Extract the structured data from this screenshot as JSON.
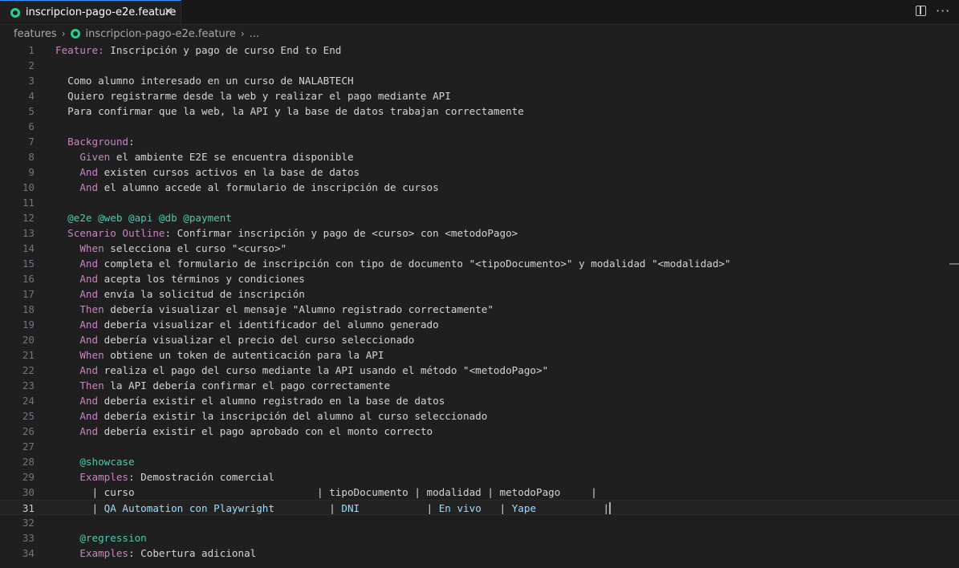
{
  "tab": {
    "title": "inscripcion-pago-e2e.feature",
    "icon": "gherkin-file-icon",
    "close": "✕"
  },
  "breadcrumb": {
    "folder": "features",
    "file": "inscripcion-pago-e2e.feature",
    "ellipsis": "..."
  },
  "colors": {
    "keyword": "#c586c0",
    "tag": "#4ec9b0",
    "table_value": "#9cdcfe",
    "text": "#d4d4d4",
    "accent": "#3794ff"
  },
  "lines": [
    {
      "n": "1",
      "segs": [
        {
          "t": "Feature:",
          "c": "kw"
        },
        {
          "t": " Inscripción y pago de curso End to End"
        }
      ]
    },
    {
      "n": "2",
      "segs": []
    },
    {
      "n": "3",
      "segs": [
        {
          "t": "  Como alumno interesado en un curso de NALABTECH"
        }
      ]
    },
    {
      "n": "4",
      "segs": [
        {
          "t": "  Quiero registrarme desde la web y realizar el pago mediante API"
        }
      ]
    },
    {
      "n": "5",
      "segs": [
        {
          "t": "  Para confirmar que la web, la API y la base de datos trabajan correctamente"
        }
      ]
    },
    {
      "n": "6",
      "segs": []
    },
    {
      "n": "7",
      "segs": [
        {
          "t": "  "
        },
        {
          "t": "Background",
          "c": "kw"
        },
        {
          "t": ":"
        }
      ]
    },
    {
      "n": "8",
      "segs": [
        {
          "t": "    "
        },
        {
          "t": "Given",
          "c": "kw"
        },
        {
          "t": " el ambiente E2E se encuentra disponible"
        }
      ]
    },
    {
      "n": "9",
      "segs": [
        {
          "t": "    "
        },
        {
          "t": "And",
          "c": "kw"
        },
        {
          "t": " existen cursos activos en la base de datos"
        }
      ]
    },
    {
      "n": "10",
      "segs": [
        {
          "t": "    "
        },
        {
          "t": "And",
          "c": "kw"
        },
        {
          "t": " el alumno accede al formulario de inscripción de cursos"
        }
      ]
    },
    {
      "n": "11",
      "segs": []
    },
    {
      "n": "12",
      "segs": [
        {
          "t": "  "
        },
        {
          "t": "@e2e @web @api @db @payment",
          "c": "tag"
        }
      ]
    },
    {
      "n": "13",
      "segs": [
        {
          "t": "  "
        },
        {
          "t": "Scenario Outline",
          "c": "kw"
        },
        {
          "t": ": Confirmar inscripción y pago de <curso> con <metodoPago>"
        }
      ]
    },
    {
      "n": "14",
      "segs": [
        {
          "t": "    "
        },
        {
          "t": "When",
          "c": "kw"
        },
        {
          "t": " selecciona el curso \"<curso>\""
        }
      ]
    },
    {
      "n": "15",
      "segs": [
        {
          "t": "    "
        },
        {
          "t": "And",
          "c": "kw"
        },
        {
          "t": " completa el formulario de inscripción con tipo de documento \"<tipoDocumento>\" y modalidad \"<modalidad>\""
        }
      ]
    },
    {
      "n": "16",
      "segs": [
        {
          "t": "    "
        },
        {
          "t": "And",
          "c": "kw"
        },
        {
          "t": " acepta los términos y condiciones"
        }
      ]
    },
    {
      "n": "17",
      "segs": [
        {
          "t": "    "
        },
        {
          "t": "And",
          "c": "kw"
        },
        {
          "t": " envía la solicitud de inscripción"
        }
      ]
    },
    {
      "n": "18",
      "segs": [
        {
          "t": "    "
        },
        {
          "t": "Then",
          "c": "kw"
        },
        {
          "t": " debería visualizar el mensaje \"Alumno registrado correctamente\""
        }
      ]
    },
    {
      "n": "19",
      "segs": [
        {
          "t": "    "
        },
        {
          "t": "And",
          "c": "kw"
        },
        {
          "t": " debería visualizar el identificador del alumno generado"
        }
      ]
    },
    {
      "n": "20",
      "segs": [
        {
          "t": "    "
        },
        {
          "t": "And",
          "c": "kw"
        },
        {
          "t": " debería visualizar el precio del curso seleccionado"
        }
      ]
    },
    {
      "n": "21",
      "segs": [
        {
          "t": "    "
        },
        {
          "t": "When",
          "c": "kw"
        },
        {
          "t": " obtiene un token de autenticación para la API"
        }
      ]
    },
    {
      "n": "22",
      "segs": [
        {
          "t": "    "
        },
        {
          "t": "And",
          "c": "kw"
        },
        {
          "t": " realiza el pago del curso mediante la API usando el método \"<metodoPago>\""
        }
      ]
    },
    {
      "n": "23",
      "segs": [
        {
          "t": "    "
        },
        {
          "t": "Then",
          "c": "kw"
        },
        {
          "t": " la API debería confirmar el pago correctamente"
        }
      ]
    },
    {
      "n": "24",
      "segs": [
        {
          "t": "    "
        },
        {
          "t": "And",
          "c": "kw"
        },
        {
          "t": " debería existir el alumno registrado en la base de datos"
        }
      ]
    },
    {
      "n": "25",
      "segs": [
        {
          "t": "    "
        },
        {
          "t": "And",
          "c": "kw"
        },
        {
          "t": " debería existir la inscripción del alumno al curso seleccionado"
        }
      ]
    },
    {
      "n": "26",
      "segs": [
        {
          "t": "    "
        },
        {
          "t": "And",
          "c": "kw"
        },
        {
          "t": " debería existir el pago aprobado con el monto correcto"
        }
      ]
    },
    {
      "n": "27",
      "segs": []
    },
    {
      "n": "28",
      "segs": [
        {
          "t": "    "
        },
        {
          "t": "@showcase",
          "c": "tag"
        }
      ]
    },
    {
      "n": "29",
      "segs": [
        {
          "t": "    "
        },
        {
          "t": "Examples",
          "c": "kw"
        },
        {
          "t": ": Demostración comercial"
        }
      ]
    },
    {
      "n": "30",
      "segs": [
        {
          "t": "      | curso                              | tipoDocumento | modalidad | metodoPago     |"
        }
      ]
    },
    {
      "n": "31",
      "current": true,
      "segs": [
        {
          "t": "      | "
        },
        {
          "t": "QA Automation con Playwright",
          "c": "tbl-val"
        },
        {
          "t": "         | "
        },
        {
          "t": "DNI",
          "c": "tbl-val"
        },
        {
          "t": "           | "
        },
        {
          "t": "En vivo",
          "c": "tbl-val"
        },
        {
          "t": "   | "
        },
        {
          "t": "Yape",
          "c": "tbl-val"
        },
        {
          "t": "           |"
        }
      ]
    },
    {
      "n": "32",
      "segs": []
    },
    {
      "n": "33",
      "segs": [
        {
          "t": "    "
        },
        {
          "t": "@regression",
          "c": "tag"
        }
      ]
    },
    {
      "n": "34",
      "segs": [
        {
          "t": "    "
        },
        {
          "t": "Examples",
          "c": "kw"
        },
        {
          "t": ": Cobertura adicional"
        }
      ]
    }
  ]
}
